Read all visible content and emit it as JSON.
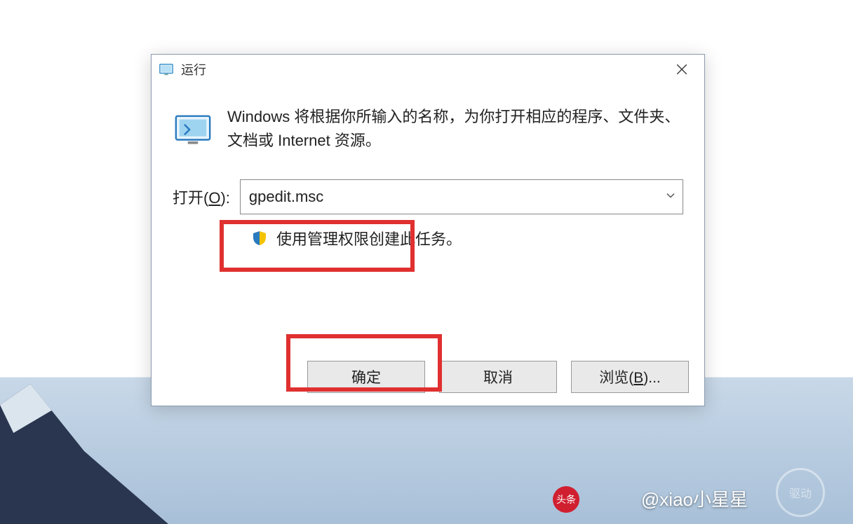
{
  "dialog": {
    "title": "运行",
    "description": "Windows 将根据你所输入的名称，为你打开相应的程序、文件夹、文档或 Internet 资源。",
    "open_label_prefix": "打开(",
    "open_label_hotkey": "O",
    "open_label_suffix": "):",
    "input_value": "gpedit.msc",
    "admin_note": "使用管理权限创建此任务。",
    "buttons": {
      "ok": "确定",
      "cancel": "取消",
      "browse_prefix": "浏览(",
      "browse_hotkey": "B",
      "browse_suffix": ")..."
    }
  },
  "watermark": {
    "avatar": "头条",
    "text": "@xiao小星星",
    "badge": "驱动"
  }
}
